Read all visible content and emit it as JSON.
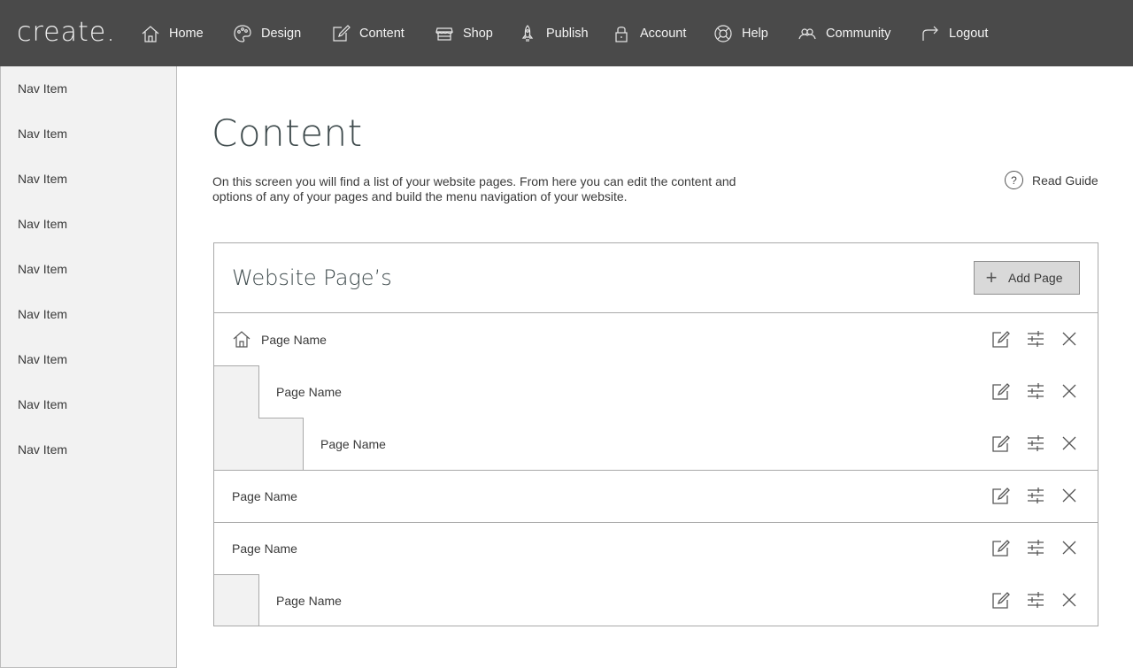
{
  "header": {
    "logo": "create.",
    "nav": [
      {
        "label": "Home",
        "icon": "home-icon"
      },
      {
        "label": "Design",
        "icon": "palette-icon"
      },
      {
        "label": "Content",
        "icon": "edit-icon"
      },
      {
        "label": "Shop",
        "icon": "store-icon"
      },
      {
        "label": "Publish",
        "icon": "rocket-icon"
      },
      {
        "label": "Account",
        "icon": "lock-icon"
      },
      {
        "label": "Help",
        "icon": "lifebuoy-icon"
      },
      {
        "label": "Community",
        "icon": "people-icon"
      },
      {
        "label": "Logout",
        "icon": "exit-arrow-icon"
      }
    ]
  },
  "sidebar": {
    "items": [
      "Nav Item",
      "Nav Item",
      "Nav Item",
      "Nav Item",
      "Nav Item",
      "Nav Item",
      "Nav Item",
      "Nav Item",
      "Nav Item"
    ]
  },
  "main": {
    "title": "Content",
    "intro": "On this screen you will find a list of your website pages. From here you can edit the content and options of any of your pages and build the menu navigation of your website.",
    "guide_label": "Read Guide",
    "guide_icon_text": "?"
  },
  "panel": {
    "title": "Website Page’s",
    "add_button_label": "Add Page",
    "add_button_icon": "+",
    "pages": [
      {
        "name": "Page Name",
        "level": 0,
        "is_home": true
      },
      {
        "name": "Page Name",
        "level": 1,
        "is_home": false
      },
      {
        "name": "Page Name",
        "level": 2,
        "is_home": false
      },
      {
        "name": "Page Name",
        "level": 0,
        "is_home": false
      },
      {
        "name": "Page Name",
        "level": 0,
        "is_home": false
      },
      {
        "name": "Page Name",
        "level": 1,
        "is_home": false
      }
    ],
    "row_actions": [
      "edit-icon",
      "settings-sliders-icon",
      "delete-x-icon"
    ]
  },
  "colors": {
    "topbar": "#4a4a4a",
    "sidebar": "#f2f2f2",
    "border": "#a9a9a9",
    "button_bg": "#d9d9d9"
  }
}
